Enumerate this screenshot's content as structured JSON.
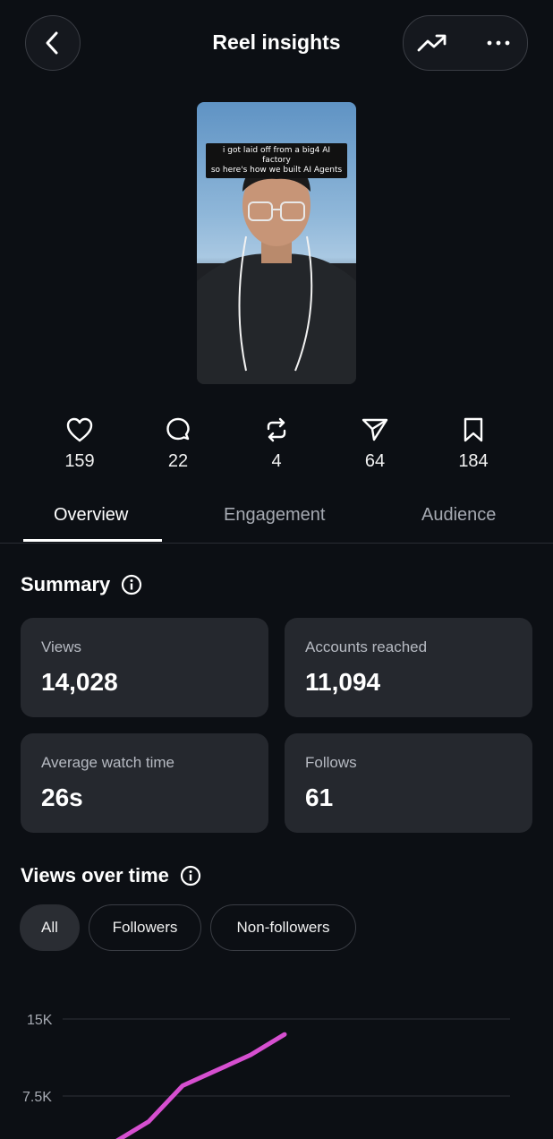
{
  "header": {
    "title": "Reel insights"
  },
  "reel": {
    "caption_line1": "i got laid off from a big4 AI factory",
    "caption_line2": "so here's how we built AI Agents"
  },
  "stats": [
    {
      "icon": "heart-icon",
      "value": "159"
    },
    {
      "icon": "comment-icon",
      "value": "22"
    },
    {
      "icon": "repost-icon",
      "value": "4"
    },
    {
      "icon": "share-icon",
      "value": "64"
    },
    {
      "icon": "bookmark-icon",
      "value": "184"
    }
  ],
  "tabs": [
    {
      "label": "Overview",
      "active": true
    },
    {
      "label": "Engagement",
      "active": false
    },
    {
      "label": "Audience",
      "active": false
    }
  ],
  "summary": {
    "title": "Summary",
    "cards": [
      {
        "label": "Views",
        "value": "14,028"
      },
      {
        "label": "Accounts reached",
        "value": "11,094"
      },
      {
        "label": "Average watch time",
        "value": "26s"
      },
      {
        "label": "Follows",
        "value": "61"
      }
    ]
  },
  "views_over_time": {
    "title": "Views over time",
    "filters": [
      {
        "label": "All",
        "active": true
      },
      {
        "label": "Followers",
        "active": false
      },
      {
        "label": "Non-followers",
        "active": false
      }
    ]
  },
  "colors": {
    "accent_line": "#d64fd0",
    "background": "#0c0f14",
    "card": "#25282e"
  },
  "chart_data": {
    "type": "line",
    "y_tick_labels": [
      "15K",
      "7.5K"
    ],
    "ylim": [
      0,
      15000
    ],
    "series": [
      {
        "values": [
          0,
          3000,
          5000,
          8500,
          10000,
          11500,
          13500
        ]
      }
    ]
  }
}
